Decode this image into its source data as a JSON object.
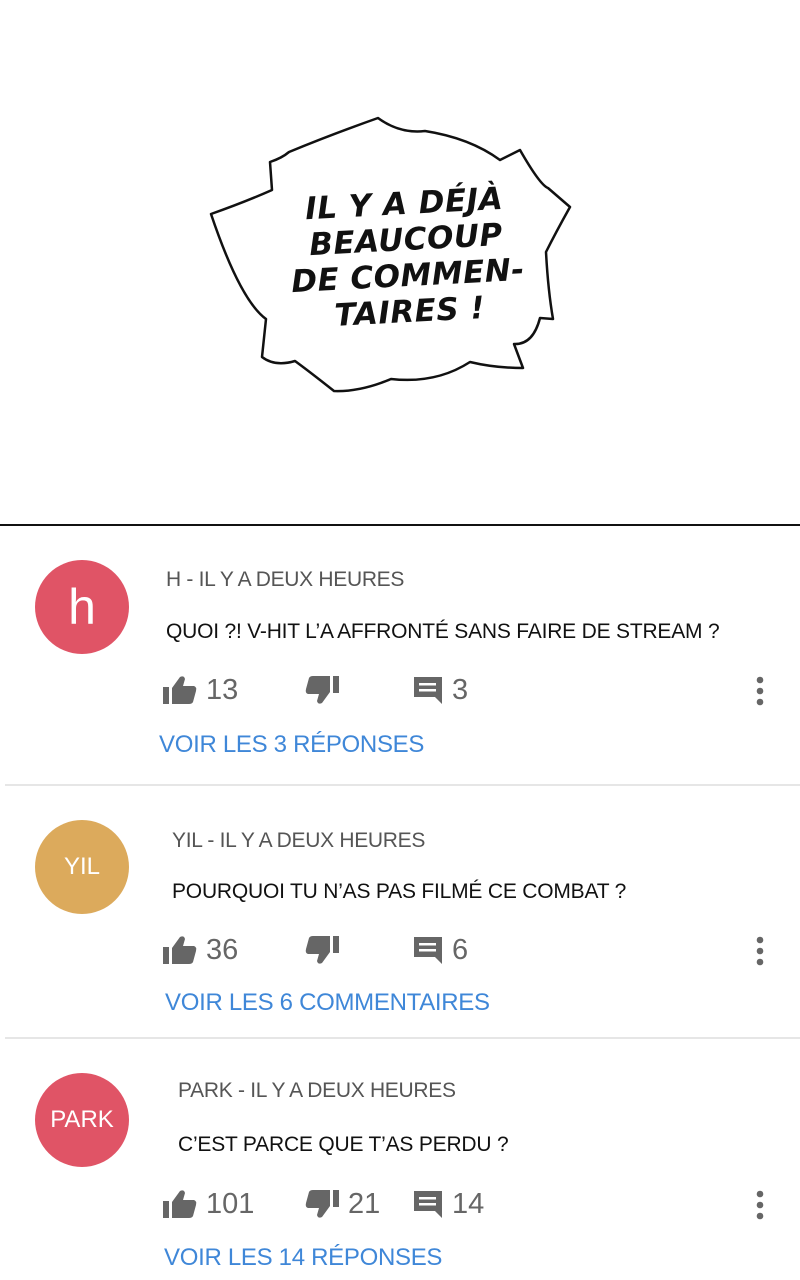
{
  "speech_bubble": {
    "lines": [
      "IL Y A DÉJÀ",
      "BEAUCOUP",
      "DE COMMEN-",
      "TAIRES !"
    ]
  },
  "colors": {
    "avatar_red": "#e05466",
    "avatar_gold": "#dcaa5c",
    "link_blue": "#3f87d8",
    "icon_gray": "#666666"
  },
  "comments": [
    {
      "avatar_label": "h",
      "meta": "H - IL Y A DEUX HEURES",
      "text": "QUOI ?! V-HIT L’A AFFRONTÉ SANS FAIRE DE STREAM ?",
      "likes": "13",
      "dislikes": "",
      "replies": "3",
      "link": "VOIR LES 3 RÉPONSES"
    },
    {
      "avatar_label": "YIL",
      "meta": "YIL - IL Y A DEUX HEURES",
      "text": "POURQUOI TU N’AS PAS FILMÉ CE COMBAT ?",
      "likes": "36",
      "dislikes": "",
      "replies": "6",
      "link": "VOIR LES 6 COMMENTAIRES"
    },
    {
      "avatar_label": "PARK",
      "meta": "PARK - IL Y A DEUX HEURES",
      "text": "C’EST PARCE QUE T’AS PERDU ?",
      "likes": "101",
      "dislikes": "21",
      "replies": "14",
      "link": "VOIR LES 14 RÉPONSES"
    }
  ]
}
